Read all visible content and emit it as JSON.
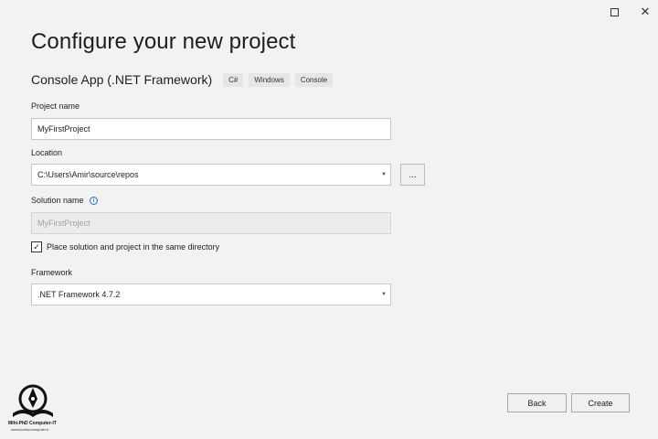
{
  "window": {
    "maximize_glyph": "maximize-icon",
    "close_glyph": "✕"
  },
  "header": {
    "title": "Configure your new project",
    "template_name": "Console App (.NET Framework)",
    "tags": [
      "C#",
      "Windows",
      "Console"
    ]
  },
  "form": {
    "project_name": {
      "label": "Project name",
      "value": "MyFirstProject"
    },
    "location": {
      "label": "Location",
      "value": "C:\\Users\\Amir\\source\\repos",
      "browse_label": "..."
    },
    "solution_name": {
      "label": "Solution name",
      "placeholder": "MyFirstProject",
      "info_glyph": "i"
    },
    "same_directory": {
      "label": "Place solution and project in the same directory",
      "checked": true,
      "check_glyph": "✓"
    },
    "framework": {
      "label": "Framework",
      "value": ".NET Framework 4.7.2"
    }
  },
  "footer": {
    "back_label": "Back",
    "create_label": "Create"
  },
  "watermark": {
    "title": "Mihi-PhD Computer-IT",
    "url": "www.konkurcomputer.ir"
  },
  "colors": {
    "background": "#f2f2f2",
    "accent": "#1a73c9"
  }
}
